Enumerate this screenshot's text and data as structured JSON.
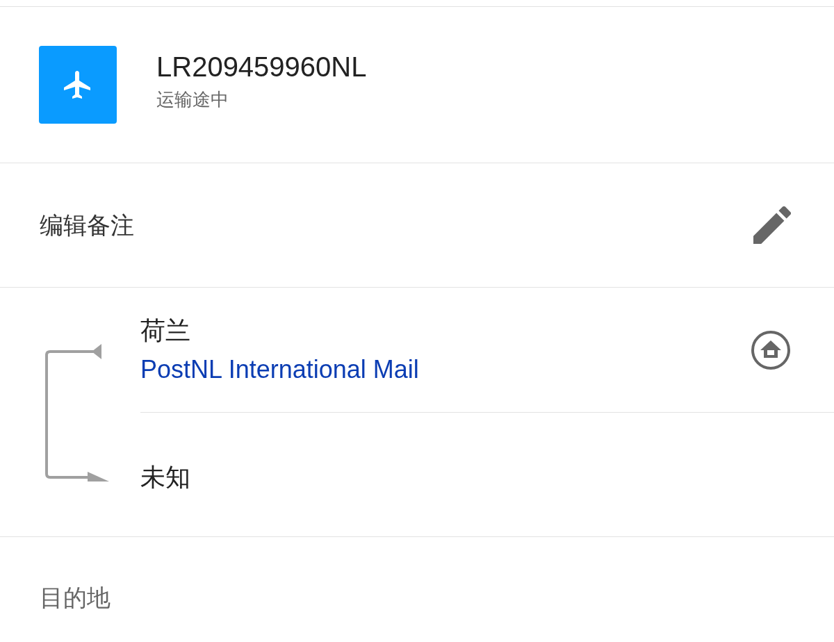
{
  "shipment": {
    "tracking_number": "LR209459960NL",
    "status": "运输途中"
  },
  "note": {
    "label": "编辑备注"
  },
  "route": {
    "origin": {
      "country": "荷兰",
      "carrier": "PostNL International Mail"
    },
    "destination": {
      "country": "未知"
    }
  },
  "destination_section": {
    "label": "目的地"
  }
}
